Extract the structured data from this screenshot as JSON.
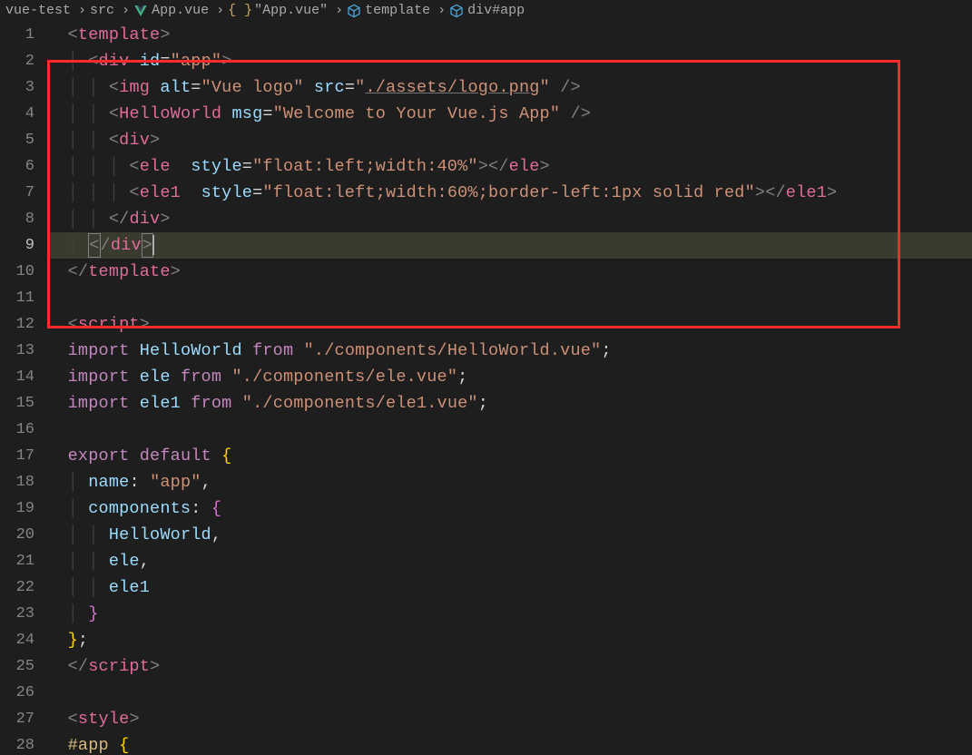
{
  "breadcrumbs": {
    "c1": "vue-test",
    "c2": "src",
    "c3": "App.vue",
    "c4": "\"App.vue\"",
    "c5": "template",
    "c6": "div#app"
  },
  "gutter": {
    "l1": "1",
    "l2": "2",
    "l3": "3",
    "l4": "4",
    "l5": "5",
    "l6": "6",
    "l7": "7",
    "l8": "8",
    "l9": "9",
    "l10": "10",
    "l11": "11",
    "l12": "12",
    "l13": "13",
    "l14": "14",
    "l15": "15",
    "l16": "16",
    "l17": "17",
    "l18": "18",
    "l19": "19",
    "l20": "20",
    "l21": "21",
    "l22": "22",
    "l23": "23",
    "l24": "24",
    "l25": "25",
    "l26": "26",
    "l27": "27",
    "l28": "28"
  },
  "code": {
    "l1": {
      "a": "<",
      "tag": "template",
      "b": ">"
    },
    "l2": {
      "a": "<",
      "tag": "div",
      "sp": " ",
      "attr": "id",
      "eq": "=",
      "val": "\"app\"",
      "b": ">"
    },
    "l3": {
      "a": "<",
      "tag": "img",
      "sp": " ",
      "attr1": "alt",
      "eq": "=",
      "val1": "\"Vue logo\"",
      "sp2": " ",
      "attr2": "src",
      "val2a": "\"",
      "val2b": "./assets/logo.png",
      "val2c": "\"",
      "b": " />"
    },
    "l4": {
      "a": "<",
      "tag": "HelloWorld",
      "sp": " ",
      "attr": "msg",
      "eq": "=",
      "val": "\"Welcome to Your Vue.js App\"",
      "b": " />"
    },
    "l5": {
      "a": "<",
      "tag": "div",
      "b": ">"
    },
    "l6": {
      "a": "<",
      "tag": "ele",
      "sp": "  ",
      "attr": "style",
      "eq": "=",
      "val": "\"float:left;width:40%\"",
      "b": "></",
      "tag2": "ele",
      "c": ">"
    },
    "l7": {
      "a": "<",
      "tag": "ele1",
      "sp": "  ",
      "attr": "style",
      "eq": "=",
      "val": "\"float:left;width:60%;border-left:1px solid red\"",
      "b": "></",
      "tag2": "ele1",
      "c": ">"
    },
    "l8": {
      "a": "</",
      "tag": "div",
      "b": ">"
    },
    "l9": {
      "a": "<",
      "s": "/",
      "tag": "div",
      "b": ">"
    },
    "l10": {
      "a": "</",
      "tag": "template",
      "b": ">"
    },
    "l12": {
      "a": "<",
      "tag": "script",
      "b": ">"
    },
    "l13": {
      "kw": "import",
      "sp": " ",
      "id": "HelloWorld",
      "sp2": " ",
      "kw2": "from",
      "sp3": " ",
      "str": "\"./components/HelloWorld.vue\"",
      "semi": ";"
    },
    "l14": {
      "kw": "import",
      "sp": " ",
      "id": "ele",
      "sp2": " ",
      "kw2": "from",
      "sp3": " ",
      "str": "\"./components/ele.vue\"",
      "semi": ";"
    },
    "l15": {
      "kw": "import",
      "sp": " ",
      "id": "ele1",
      "sp2": " ",
      "kw2": "from",
      "sp3": " ",
      "str": "\"./components/ele1.vue\"",
      "semi": ";"
    },
    "l17": {
      "kw": "export",
      "sp": " ",
      "kw2": "default",
      "sp2": " ",
      "brace": "{"
    },
    "l18": {
      "id": "name",
      "colon": ":",
      "sp": " ",
      "str": "\"app\"",
      "comma": ","
    },
    "l19": {
      "id": "components",
      "colon": ":",
      "sp": " ",
      "brace": "{"
    },
    "l20": {
      "id": "HelloWorld",
      "comma": ","
    },
    "l21": {
      "id": "ele",
      "comma": ","
    },
    "l22": {
      "id": "ele1"
    },
    "l23": {
      "brace": "}"
    },
    "l24": {
      "brace": "}",
      "semi": ";"
    },
    "l25": {
      "a": "</",
      "tag": "script",
      "b": ">"
    },
    "l27": {
      "a": "<",
      "tag": "style",
      "b": ">"
    },
    "l28": {
      "sel": "#app",
      "sp": " ",
      "brace": "{"
    }
  }
}
